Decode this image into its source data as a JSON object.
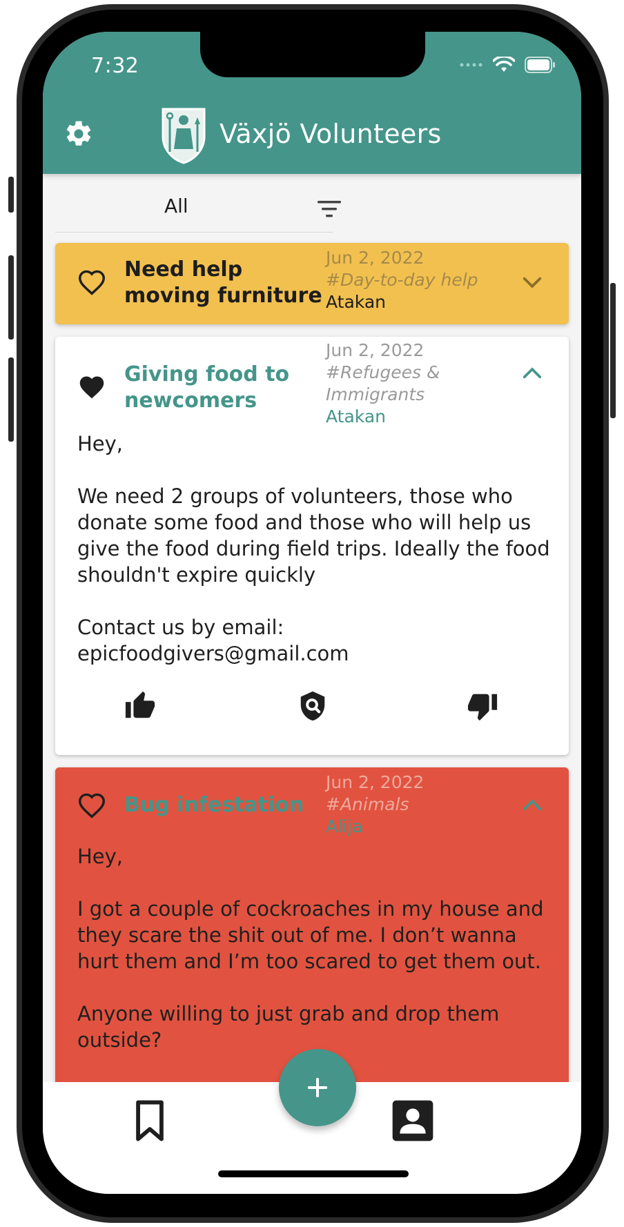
{
  "status": {
    "time": "7:32"
  },
  "header": {
    "title": "Växjö Volunteers"
  },
  "filter": {
    "value": "All"
  },
  "posts": [
    {
      "title": "Need help moving furniture",
      "date": "Jun 2, 2022",
      "category": "#Day-to-day help",
      "author": "Atakan",
      "state": "collapsed",
      "background": "#f2c04f"
    },
    {
      "title": "Giving food to newcomers",
      "date": "Jun 2, 2022",
      "category": "#Refugees & Immigrants",
      "author": "Atakan",
      "state": "expanded",
      "background": "#ffffff",
      "body": "Hey,\n\nWe need 2 groups of volunteers, those who donate some food and those who will help us give the food during field trips. Ideally the food shouldn't expire quickly\n\nContact us by email:\nepicfoodgivers@gmail.com"
    },
    {
      "title": "Bug infestation",
      "date": "Jun 2, 2022",
      "category": "#Animals",
      "author": "Alija",
      "state": "expanded",
      "background": "#e15340",
      "body": "Hey,\n\nI got a couple of cockroaches in my house and they scare the shit out of me. I don’t wanna hurt them and I’m too scared to get them out.\n\nAnyone willing to just grab and drop them outside?"
    }
  ],
  "colors": {
    "primary": "#45958a",
    "yellow": "#f2c04f",
    "red": "#e15340"
  },
  "icons": [
    "gear-icon",
    "crest-logo",
    "filter-icon",
    "heart-outline-icon",
    "heart-filled-icon",
    "chevron-down-icon",
    "chevron-up-icon",
    "thumbs-up-icon",
    "shield-search-icon",
    "thumbs-down-icon",
    "bookmark-icon",
    "profile-icon",
    "plus-icon"
  ]
}
